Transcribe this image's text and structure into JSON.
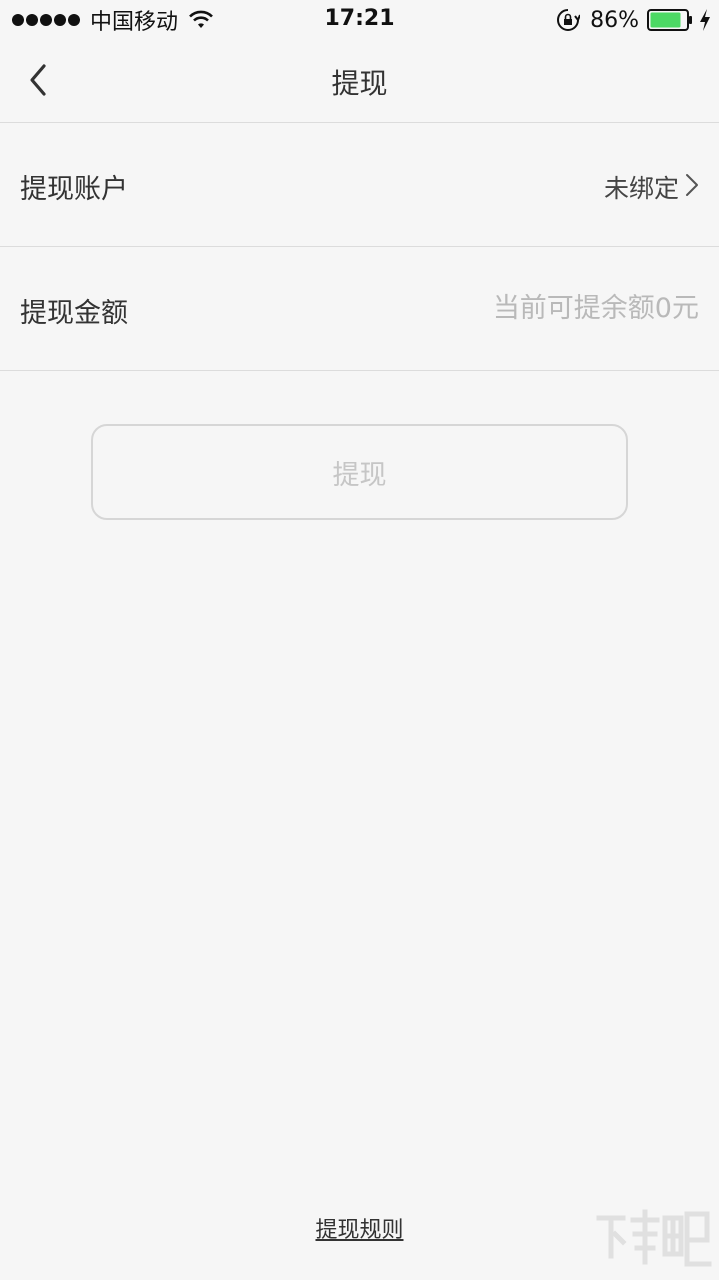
{
  "status_bar": {
    "carrier": "中国移动",
    "time": "17:21",
    "battery": "86%",
    "icons": [
      "signal-icon",
      "wifi-icon",
      "orientation-lock-icon",
      "battery-icon",
      "charging-icon"
    ]
  },
  "nav": {
    "title": "提现",
    "back_icon": "chevron-left-icon"
  },
  "account_row": {
    "label": "提现账户",
    "value": "未绑定"
  },
  "amount_row": {
    "label": "提现金额",
    "placeholder": "当前可提余额0元",
    "value": ""
  },
  "withdraw_button": {
    "label": "提现",
    "enabled": false
  },
  "footer": {
    "rules_link": "提现规则"
  },
  "colors": {
    "background": "#f6f6f6",
    "divider": "#dcdcdc",
    "disabled_text": "#c6c6c6",
    "battery_fill": "#4cd964"
  }
}
